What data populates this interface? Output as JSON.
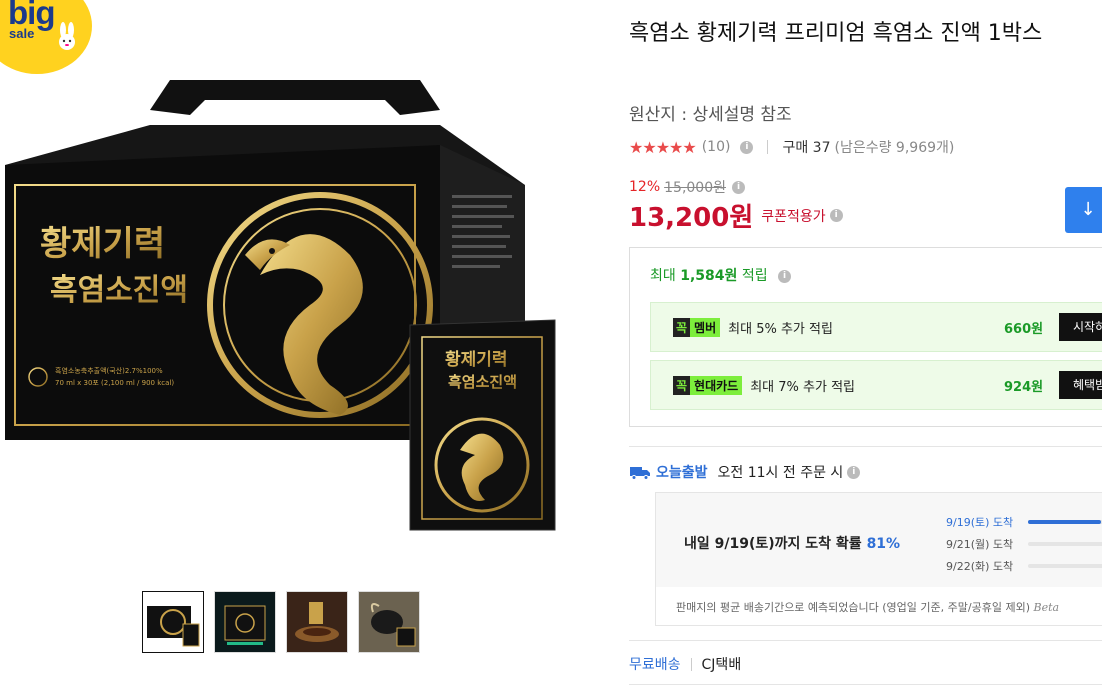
{
  "badge": {
    "big": "big",
    "sale": "sale"
  },
  "product": {
    "box_title_line1": "황제기력",
    "box_title_line2": "흑염소진액",
    "pouch_title_line1": "황제기력",
    "pouch_title_line2": "흑염소진액",
    "box_small_text": "흑염소농축추출액(국산)2.7%100%",
    "box_small_text2": "70 ml x 30포 (2,100 ml / 900 kcal)"
  },
  "thumbnails": [
    {
      "name": "thumb-box",
      "active": true
    },
    {
      "name": "thumb-pouch-set",
      "active": false
    },
    {
      "name": "thumb-serving",
      "active": false
    },
    {
      "name": "thumb-goat",
      "active": false
    }
  ],
  "title": "흑염소 황제기력 프리미엄 흑염소 진액 1박스",
  "origin": "원산지 : 상세설명 참조",
  "rating": {
    "stars": "★★★★★",
    "count": "(10)",
    "buy": "구매 37",
    "remain": "(남은수량 9,969개)"
  },
  "pricing": {
    "discount_rate": "12%",
    "original_price": "15,000원",
    "price": "13,200원",
    "coupon_note": "쿠폰적용가"
  },
  "rewards": {
    "head_prefix": "최대 ",
    "head_amount": "1,584원",
    "head_suffix": " 적립",
    "items": [
      {
        "tag_k": "꼭",
        "tag_t": "멤버",
        "text": "최대 5% 추가 적립",
        "amount": "660원",
        "button": "시작하"
      },
      {
        "tag_k": "꼭",
        "tag_t": "현대카드",
        "text": "최대 7% 추가 적립",
        "amount": "924원",
        "button": "혜택받"
      }
    ]
  },
  "shipping": {
    "today": "오늘출발",
    "cutoff": "오전 11시 전 주문 시",
    "eta_main_prefix": "내일 9/19(토)까지 도착 확률 ",
    "eta_pct": "81%",
    "eta_rows": [
      {
        "label": "9/19(토) 도착",
        "fill": 0.81
      },
      {
        "label": "9/21(월) 도착",
        "fill": 0.0
      },
      {
        "label": "9/22(화) 도착",
        "fill": 0.0
      }
    ],
    "note": "판매지의 평균 배송기간으로 예측되었습니다 (영업일 기준, 주말/공휴일 제외)",
    "note_beta": "Beta",
    "free": "무료배송",
    "carrier": "CJ택배"
  },
  "colors": {
    "price_red": "#c8102e",
    "reward_green": "#1a9a27",
    "accent_blue": "#2f80ed",
    "star_red": "#e94b4b",
    "gold": "#c9a24a"
  }
}
